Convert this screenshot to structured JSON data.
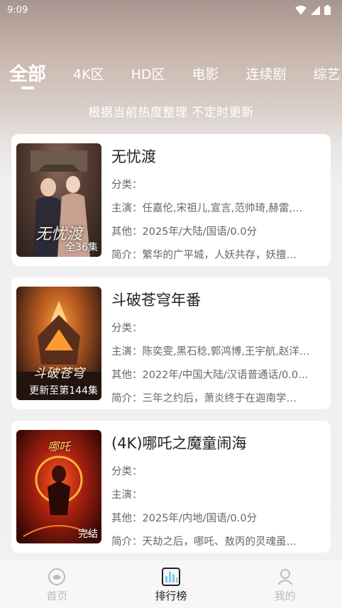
{
  "status_bar": {
    "time": "9:09"
  },
  "tabs": [
    {
      "label": "全部",
      "active": true
    },
    {
      "label": "4K区",
      "active": false
    },
    {
      "label": "HD区",
      "active": false
    },
    {
      "label": "电影",
      "active": false
    },
    {
      "label": "连续剧",
      "active": false
    },
    {
      "label": "综艺",
      "active": false
    }
  ],
  "subtitle": "根据当前热度整理 不定时更新",
  "items": [
    {
      "title": "无忧渡",
      "badge": "全36集",
      "category": "分类：",
      "cast": "主演：任嘉伦,宋祖儿,宣言,范帅琦,赫雷,…",
      "other": "其他：2025年/大陆/国语/0.0分",
      "intro": "简介：繁华的广平城，人妖共存，妖擅…",
      "poster_text": "无忧渡"
    },
    {
      "title": "斗破苍穹年番",
      "badge": "更新至第144集",
      "category": "分类：",
      "cast": "主演：陈奕雯,黑石稔,郭鸿博,王宇航,赵洋…",
      "other": "其他：2022年/中国大陆/汉语普通话/0.0…",
      "intro": "简介：三年之约后，萧炎终于在迦南学…",
      "poster_text": "斗破苍穹"
    },
    {
      "title": "(4K)哪吒之魔童闹海",
      "badge": "完结",
      "category": "分类：",
      "cast": "主演：",
      "other": "其他：2025年/内地/国语/0.0分",
      "intro": "简介：天劫之后，哪吒、敖丙的灵魂虽…",
      "poster_text": "哪吒"
    }
  ],
  "nav": [
    {
      "label": "首页",
      "icon": "home-icon",
      "active": false
    },
    {
      "label": "排行榜",
      "icon": "ranking-icon",
      "active": true
    },
    {
      "label": "我的",
      "icon": "profile-icon",
      "active": false
    }
  ],
  "colors": {
    "card_bg": "#ffffff",
    "nav_active": "#222222",
    "nav_inactive": "#bbbbbb"
  }
}
